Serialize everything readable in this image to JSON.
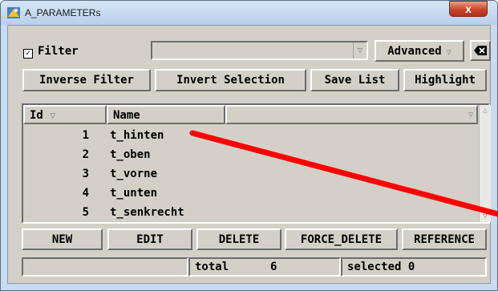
{
  "window": {
    "title": "A_PARAMETERs",
    "close_label": "x"
  },
  "toolbar": {
    "filter_label": "Filter",
    "filter_checked": true,
    "filter_combo_value": "",
    "advanced_label": "Advanced",
    "inverse_filter_label": "Inverse Filter",
    "invert_selection_label": "Invert Selection",
    "save_list_label": "Save List",
    "highlight_label": "Highlight"
  },
  "table": {
    "columns": [
      "Id",
      "Name",
      ""
    ],
    "rows": [
      {
        "id": "1",
        "name": "t_hinten"
      },
      {
        "id": "2",
        "name": "t_oben"
      },
      {
        "id": "3",
        "name": "t_vorne"
      },
      {
        "id": "4",
        "name": "t_unten"
      },
      {
        "id": "5",
        "name": "t_senkrecht"
      }
    ]
  },
  "actions": {
    "new_label": "NEW",
    "edit_label": "EDIT",
    "delete_label": "DELETE",
    "force_delete_label": "FORCE_DELETE",
    "reference_label": "REFERENCE"
  },
  "status": {
    "total_label": "total",
    "total_value": "6",
    "selected_label": "selected",
    "selected_value": "0"
  },
  "colors": {
    "annotation_line": "#ff0000",
    "title_gradient_top": "#d7e6f5",
    "close_button": "#c6452b",
    "panel_face": "#d4d0c8"
  },
  "icons": {
    "title": "app-icon",
    "clear": "clear-filter-icon"
  }
}
